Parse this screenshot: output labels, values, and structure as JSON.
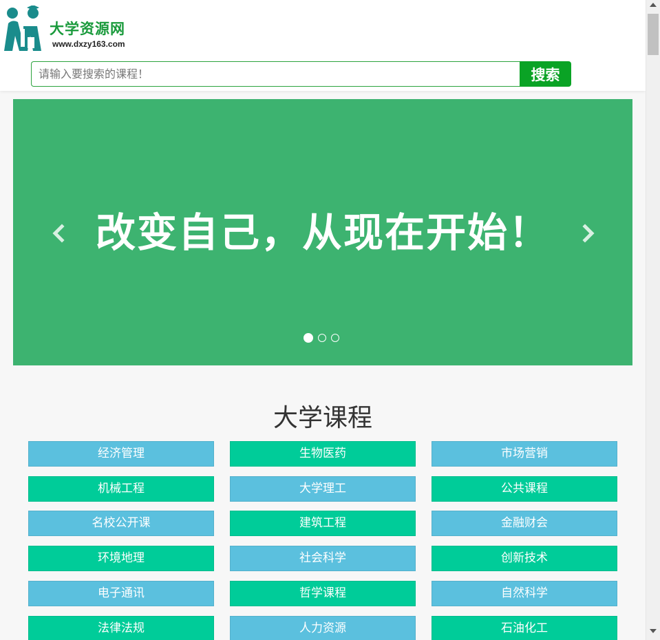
{
  "header": {
    "site_name": "大学资源网",
    "site_url": "www.dxzy163.com",
    "logo_icon": "students-logo-icon",
    "colors": {
      "brand_green": "#1a9a3c",
      "search_button": "#0aa325"
    }
  },
  "search": {
    "placeholder": "请输入要搜索的课程！",
    "value": "",
    "button_label": "搜索"
  },
  "banner": {
    "slogan": "改变自己，从现在开始！",
    "background": "#3db370",
    "prev_icon": "chevron-left-icon",
    "next_icon": "chevron-right-icon",
    "slide_count": 3,
    "active_slide": 1
  },
  "section": {
    "title": "大学课程"
  },
  "categories": [
    {
      "label": "经济管理",
      "color": "#5bc0de"
    },
    {
      "label": "生物医药",
      "color": "#00cc99"
    },
    {
      "label": "市场营销",
      "color": "#5bc0de"
    },
    {
      "label": "机械工程",
      "color": "#00cc99"
    },
    {
      "label": "大学理工",
      "color": "#5bc0de"
    },
    {
      "label": "公共课程",
      "color": "#00cc99"
    },
    {
      "label": "名校公开课",
      "color": "#5bc0de"
    },
    {
      "label": "建筑工程",
      "color": "#00cc99"
    },
    {
      "label": "金融财会",
      "color": "#5bc0de"
    },
    {
      "label": "环境地理",
      "color": "#00cc99"
    },
    {
      "label": "社会科学",
      "color": "#5bc0de"
    },
    {
      "label": "创新技术",
      "color": "#00cc99"
    },
    {
      "label": "电子通讯",
      "color": "#5bc0de"
    },
    {
      "label": "哲学课程",
      "color": "#00cc99"
    },
    {
      "label": "自然科学",
      "color": "#5bc0de"
    },
    {
      "label": "法律法规",
      "color": "#00cc99"
    },
    {
      "label": "人力资源",
      "color": "#5bc0de"
    },
    {
      "label": "石油化工",
      "color": "#00cc99"
    }
  ]
}
